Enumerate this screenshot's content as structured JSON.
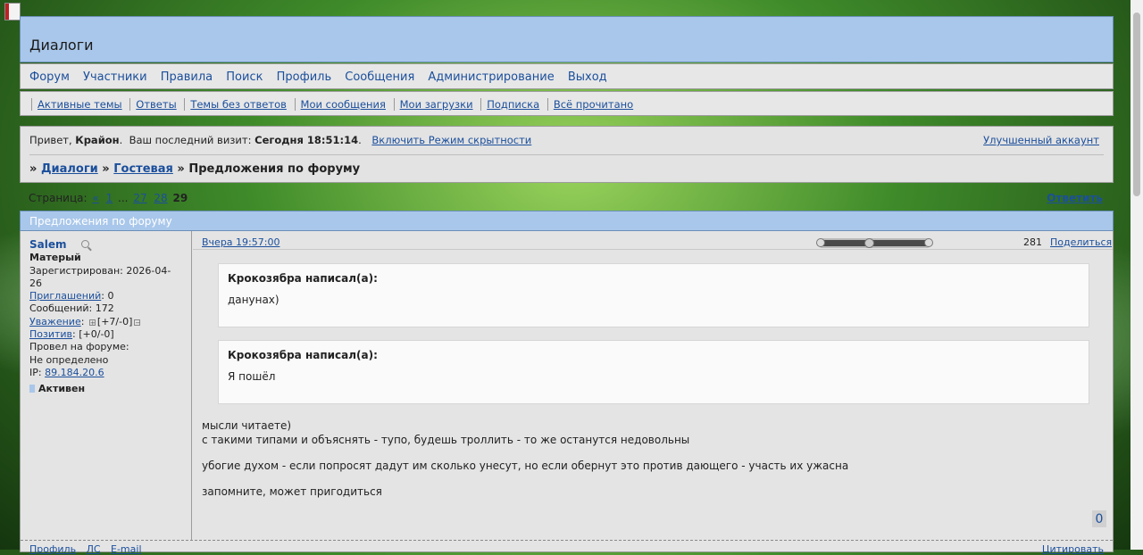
{
  "forum": {
    "title": "Диалоги"
  },
  "mainnav": [
    "Форум",
    "Участники",
    "Правила",
    "Поиск",
    "Профиль",
    "Сообщения",
    "Администрирование",
    "Выход"
  ],
  "subnav": [
    "Активные темы",
    "Ответы",
    "Темы без ответов",
    "Мои сообщения",
    "Мои загрузки",
    "Подписка",
    "Всё прочитано"
  ],
  "welcome": {
    "greeting": "Привет,",
    "user": "Крайон",
    "last_visit_label": "Ваш последний визит:",
    "last_visit": "Сегодня 18:51:14",
    "stealth": "Включить Режим скрытности",
    "premium": "Улучшенный аккаунт"
  },
  "breadcrumbs": {
    "sep": "»",
    "items": [
      "Диалоги",
      "Гостевая"
    ],
    "current": "Предложения по форуму"
  },
  "pager": {
    "label": "Страница:",
    "prev": "«",
    "first": "1",
    "dots": "...",
    "p27": "27",
    "p28": "28",
    "current": "29"
  },
  "reply_label": "Ответить",
  "topic": {
    "title": "Предложения по форуму"
  },
  "post": {
    "author": {
      "name": "Salem",
      "rank": "Матерый",
      "registered": "Зарегистрирован: 2026-04-26",
      "invites_label": "Приглашений",
      "invites_value": ": 0",
      "posts": "Сообщений: 172",
      "respect_label": "Уважение",
      "respect_value": "[+7/-0]",
      "positive_label": "Позитив",
      "positive_value": ": [+0/-0]",
      "time_label": "Провел на форуме:",
      "time_value": "Не определено",
      "ip_label": "IP:",
      "ip": "89.184.20.6",
      "status": "Активен"
    },
    "date": "Вчера 19:57:00",
    "number": "281",
    "share": "Поделиться",
    "quotes": [
      {
        "author": "Крокозябра написал(а):",
        "text": "данунах)"
      },
      {
        "author": "Крокозябра написал(а):",
        "text": "Я пошёл"
      }
    ],
    "text_line1": "мысли читаете)",
    "text_line2": "с такими типами и объяснять - тупо, будешь троллить - то же останутся недовольны",
    "text_line3": "убогие духом - если попросят дадут им сколько унесут, но если обернут это против дающего - участь их ужасна",
    "text_line4": "запомните, может пригодиться",
    "counter": "0",
    "footer": {
      "profile": "Профиль",
      "pm": "ЛС",
      "email": "E-mail",
      "quote": "Цитировать"
    }
  }
}
